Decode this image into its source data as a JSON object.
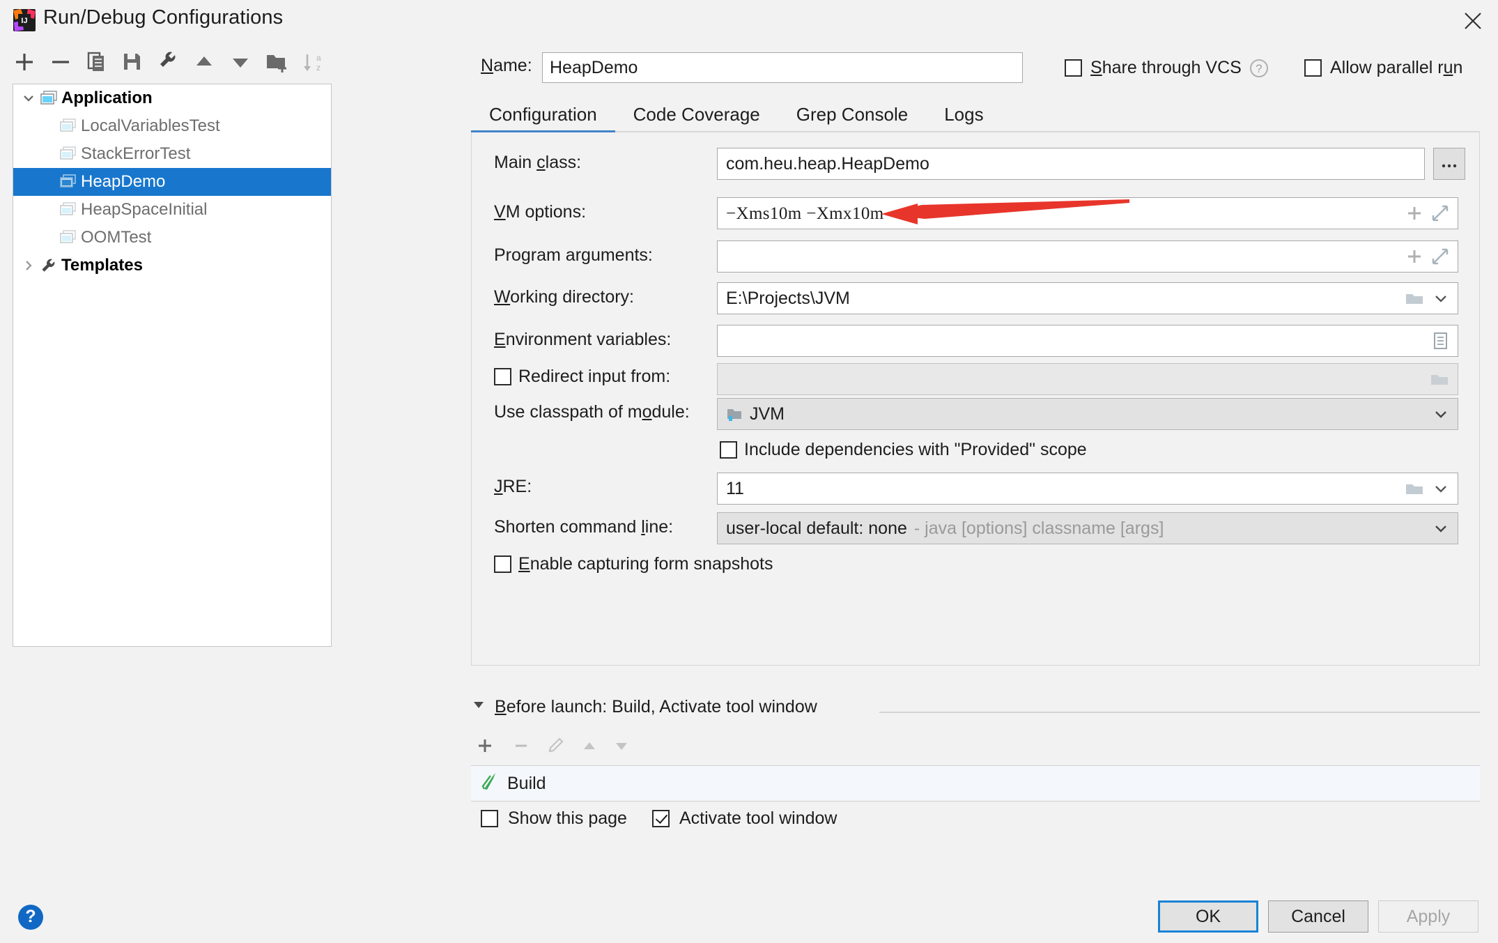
{
  "window": {
    "title": "Run/Debug Configurations",
    "close_icon": "close-icon",
    "logo": "intellij-idea-logo"
  },
  "toolbar": {
    "items": [
      {
        "name": "add-configuration",
        "icon": "plus-icon"
      },
      {
        "name": "remove-configuration",
        "icon": "minus-icon"
      },
      {
        "name": "copy-configuration",
        "icon": "copy-icon"
      },
      {
        "name": "save-configuration",
        "icon": "save-icon"
      },
      {
        "name": "edit-templates",
        "icon": "wrench-icon"
      },
      {
        "name": "move-up",
        "icon": "arrow-up-icon"
      },
      {
        "name": "move-down",
        "icon": "arrow-down-icon"
      },
      {
        "name": "new-folder",
        "icon": "folder-add-icon"
      },
      {
        "name": "sort-alphabetically",
        "icon": "sort-az-icon"
      }
    ]
  },
  "tree": {
    "nodes": [
      {
        "label": "Application",
        "level": 0,
        "expanded": true,
        "bold": true,
        "selected": false,
        "dim": false,
        "icon": "application-icon"
      },
      {
        "label": "LocalVariablesTest",
        "level": 1,
        "expanded": null,
        "bold": false,
        "selected": false,
        "dim": true,
        "icon": "run-config-icon"
      },
      {
        "label": "StackErrorTest",
        "level": 1,
        "expanded": null,
        "bold": false,
        "selected": false,
        "dim": true,
        "icon": "run-config-icon"
      },
      {
        "label": "HeapDemo",
        "level": 1,
        "expanded": null,
        "bold": false,
        "selected": true,
        "dim": false,
        "icon": "run-config-icon"
      },
      {
        "label": "HeapSpaceInitial",
        "level": 1,
        "expanded": null,
        "bold": false,
        "selected": false,
        "dim": true,
        "icon": "run-config-icon"
      },
      {
        "label": "OOMTest",
        "level": 1,
        "expanded": null,
        "bold": false,
        "selected": false,
        "dim": true,
        "icon": "run-config-icon"
      },
      {
        "label": "Templates",
        "level": 0,
        "expanded": false,
        "bold": true,
        "selected": false,
        "dim": false,
        "icon": "wrench-icon"
      }
    ]
  },
  "header": {
    "name_label": "Name:",
    "name_label_mnemonic": "N",
    "name_value": "HeapDemo",
    "share_vcs_label": "Share through VCS",
    "share_vcs_mnemonic": "S",
    "share_vcs_checked": false,
    "share_vcs_help_icon": "question-mark-icon",
    "allow_parallel_label": "Allow parallel run",
    "allow_parallel_checked": false
  },
  "tabs": [
    {
      "label": "Configuration",
      "active": true
    },
    {
      "label": "Code Coverage",
      "active": false
    },
    {
      "label": "Grep Console",
      "active": false
    },
    {
      "label": "Logs",
      "active": false
    }
  ],
  "form": {
    "main_class": {
      "label": "Main class:",
      "value": "com.heu.heap.HeapDemo",
      "browse_label": "...",
      "browse_icon": "ellipsis-icon"
    },
    "vm_options": {
      "label": "VM options:",
      "value": "−Xms10m −Xmx10m",
      "icons": [
        "plus-icon",
        "expand-icon"
      ]
    },
    "program_arguments": {
      "label": "Program arguments:",
      "value": "",
      "icons": [
        "plus-icon",
        "expand-icon"
      ]
    },
    "working_directory": {
      "label": "Working directory:",
      "value": "E:\\Projects\\JVM",
      "icons": [
        "folder-icon",
        "chevron-down-icon"
      ]
    },
    "environment_variables": {
      "label": "Environment variables:",
      "value": "",
      "icons": [
        "document-list-icon"
      ]
    },
    "redirect_input": {
      "label": "Redirect input from:",
      "checked": false,
      "value": "",
      "disabled": true,
      "icons": [
        "folder-icon"
      ]
    },
    "classpath_module": {
      "label": "Use classpath of module:",
      "value": "JVM",
      "module_icon": "module-icon",
      "icons": [
        "chevron-down-icon"
      ]
    },
    "include_provided": {
      "label": "Include dependencies with \"Provided\" scope",
      "checked": false
    },
    "jre": {
      "label": "JRE:",
      "value": "11",
      "icons": [
        "folder-icon",
        "chevron-down-icon"
      ]
    },
    "shorten_command_line": {
      "label": "Shorten command line:",
      "value": "user-local default: none",
      "hint": "- java [options] classname [args]",
      "icons": [
        "chevron-down-icon"
      ]
    },
    "enable_capturing": {
      "label": "Enable capturing form snapshots",
      "checked": false
    }
  },
  "before_launch": {
    "header": "Before launch: Build, Activate tool window",
    "collapse_icon": "triangle-down-icon",
    "toolbar": [
      {
        "name": "add-task",
        "icon": "plus-icon",
        "enabled": true
      },
      {
        "name": "remove-task",
        "icon": "minus-icon",
        "enabled": false
      },
      {
        "name": "edit-task",
        "icon": "pencil-icon",
        "enabled": false
      },
      {
        "name": "move-task-up",
        "icon": "arrow-up-icon",
        "enabled": false
      },
      {
        "name": "move-task-down",
        "icon": "arrow-down-icon",
        "enabled": false
      }
    ],
    "items": [
      {
        "label": "Build",
        "icon": "build-hammer-icon"
      }
    ],
    "show_page_label": "Show this page",
    "show_page_checked": false,
    "activate_window_label": "Activate tool window",
    "activate_window_checked": true
  },
  "footer": {
    "help_label": "?",
    "ok_label": "OK",
    "cancel_label": "Cancel",
    "apply_label": "Apply",
    "apply_enabled": false
  },
  "annotation": {
    "type": "red-arrow",
    "color": "#e8352b",
    "points_at": "vm-options-value"
  },
  "colors": {
    "selection": "#1877cd",
    "tab_underline": "#4083c9",
    "accent_button": "#1882d6",
    "annotation_red": "#e8352b",
    "help_blue": "#1068c4"
  }
}
